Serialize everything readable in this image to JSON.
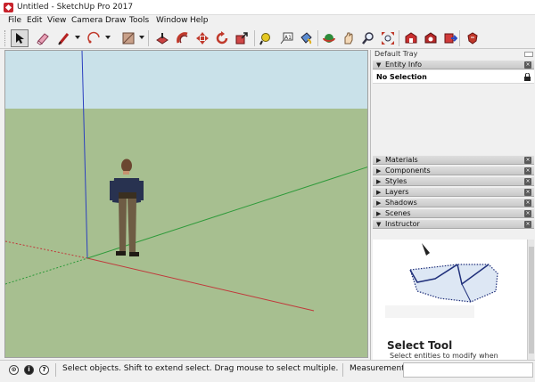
{
  "window": {
    "title": "Untitled - SketchUp Pro 2017"
  },
  "menu": [
    "File",
    "Edit",
    "View",
    "Camera",
    "Draw",
    "Tools",
    "Window",
    "Help"
  ],
  "toolbar": {
    "tools": [
      "select-icon",
      "eraser-icon",
      "line-icon",
      "arc-icon",
      "rectangle-icon",
      "push-pull-icon",
      "offset-icon",
      "move-icon",
      "rotate-icon",
      "scale-icon",
      "tape-measure-icon",
      "text-icon",
      "paint-bucket-icon",
      "orbit-icon",
      "pan-icon",
      "zoom-icon",
      "zoom-extents-icon",
      "3d-warehouse-icon",
      "extension-warehouse-icon",
      "send-to-layout-icon",
      "ruby-extension-icon"
    ]
  },
  "tray": {
    "title": "Default Tray",
    "entity_info": {
      "label": "Entity Info",
      "selection": "No Selection"
    },
    "panels": [
      "Materials",
      "Components",
      "Styles",
      "Layers",
      "Shadows",
      "Scenes"
    ],
    "instructor": {
      "label": "Instructor",
      "heading": "Select Tool",
      "description": "Select entities to modify when"
    }
  },
  "status": {
    "message": "Select objects. Shift to extend select. Drag mouse to select multiple.",
    "measurements_label": "Measurements",
    "measurements_value": ""
  },
  "colors": {
    "sky": "#c9e1e9",
    "ground": "#a7bf90",
    "axis_red": "#c0393b",
    "axis_green": "#2e9a3a",
    "axis_blue": "#2b3fbf"
  }
}
